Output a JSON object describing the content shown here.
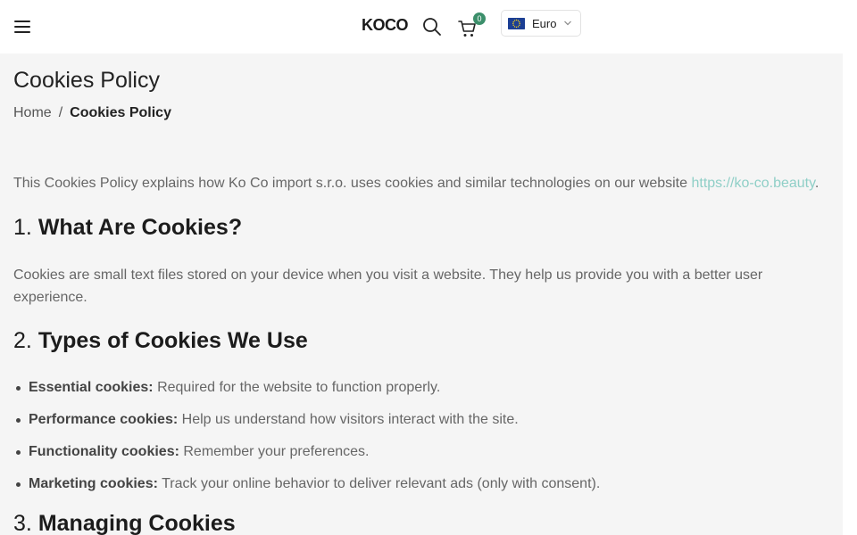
{
  "header": {
    "logo": "KOCO",
    "cart_count": "0",
    "currency": "Euro"
  },
  "page": {
    "title": "Cookies Policy",
    "breadcrumb": {
      "home": "Home",
      "separator": "/",
      "current": "Cookies Policy"
    }
  },
  "content": {
    "intro_text": "This Cookies Policy explains how Ko Co import s.r.o. uses cookies and similar technologies on our website ",
    "intro_link": "https://ko-co.beauty",
    "intro_end": ".",
    "section1": {
      "number": "1.",
      "title": "What Are Cookies?",
      "body": "Cookies are small text files stored on your device when you visit a website. They help us provide you with a better user experience."
    },
    "section2": {
      "number": "2.",
      "title": "Types of Cookies We Use",
      "items": [
        {
          "label": "Essential cookies:",
          "text": " Required for the website to function properly."
        },
        {
          "label": "Performance cookies:",
          "text": " Help us understand how visitors interact with the site."
        },
        {
          "label": "Functionality cookies:",
          "text": " Remember your preferences."
        },
        {
          "label": "Marketing cookies:",
          "text": " Track your online behavior to deliver relevant ads (only with consent)."
        }
      ]
    },
    "section3": {
      "number": "3.",
      "title": "Managing Cookies"
    }
  },
  "colors": {
    "link": "#8fcfc7",
    "badge": "#3c8f6b",
    "main_bg": "#f5f5f5"
  }
}
